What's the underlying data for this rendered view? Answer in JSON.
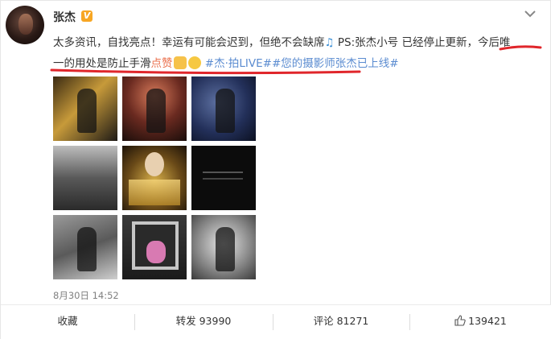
{
  "post": {
    "author": "张杰",
    "verified_badge": "V",
    "text_line1_a": "太多资讯，自找亮点！幸运有可能会迟到，但绝不会缺席",
    "music_icon": "♫",
    "text_line1_b": " PS:张杰小号 已经停止更新，今后唯",
    "text_line2_a": "一的用处是防止手滑",
    "text_line2_orange": "点赞",
    "topic_1": " #杰·拍LIVE#",
    "topic_2": "#您的摄影师张杰已上线#",
    "timestamp": "8月30日 14:52"
  },
  "images": [
    {
      "name": "photo-stage-performance-1"
    },
    {
      "name": "photo-stage-performance-2"
    },
    {
      "name": "photo-stage-performance-3"
    },
    {
      "name": "photo-concert-crowd"
    },
    {
      "name": "photo-award-poster"
    },
    {
      "name": "photo-dark-slide"
    },
    {
      "name": "photo-backstage"
    },
    {
      "name": "photo-framed-poster"
    },
    {
      "name": "photo-portrait-bw"
    }
  ],
  "actions": {
    "favorite": "收藏",
    "repost": "转发 93990",
    "comment": "评论 81271",
    "like": "139421"
  },
  "colors": {
    "accent_orange": "#eb7350",
    "topic_blue": "#5a8bd0",
    "annotation_red": "#e0262b"
  }
}
